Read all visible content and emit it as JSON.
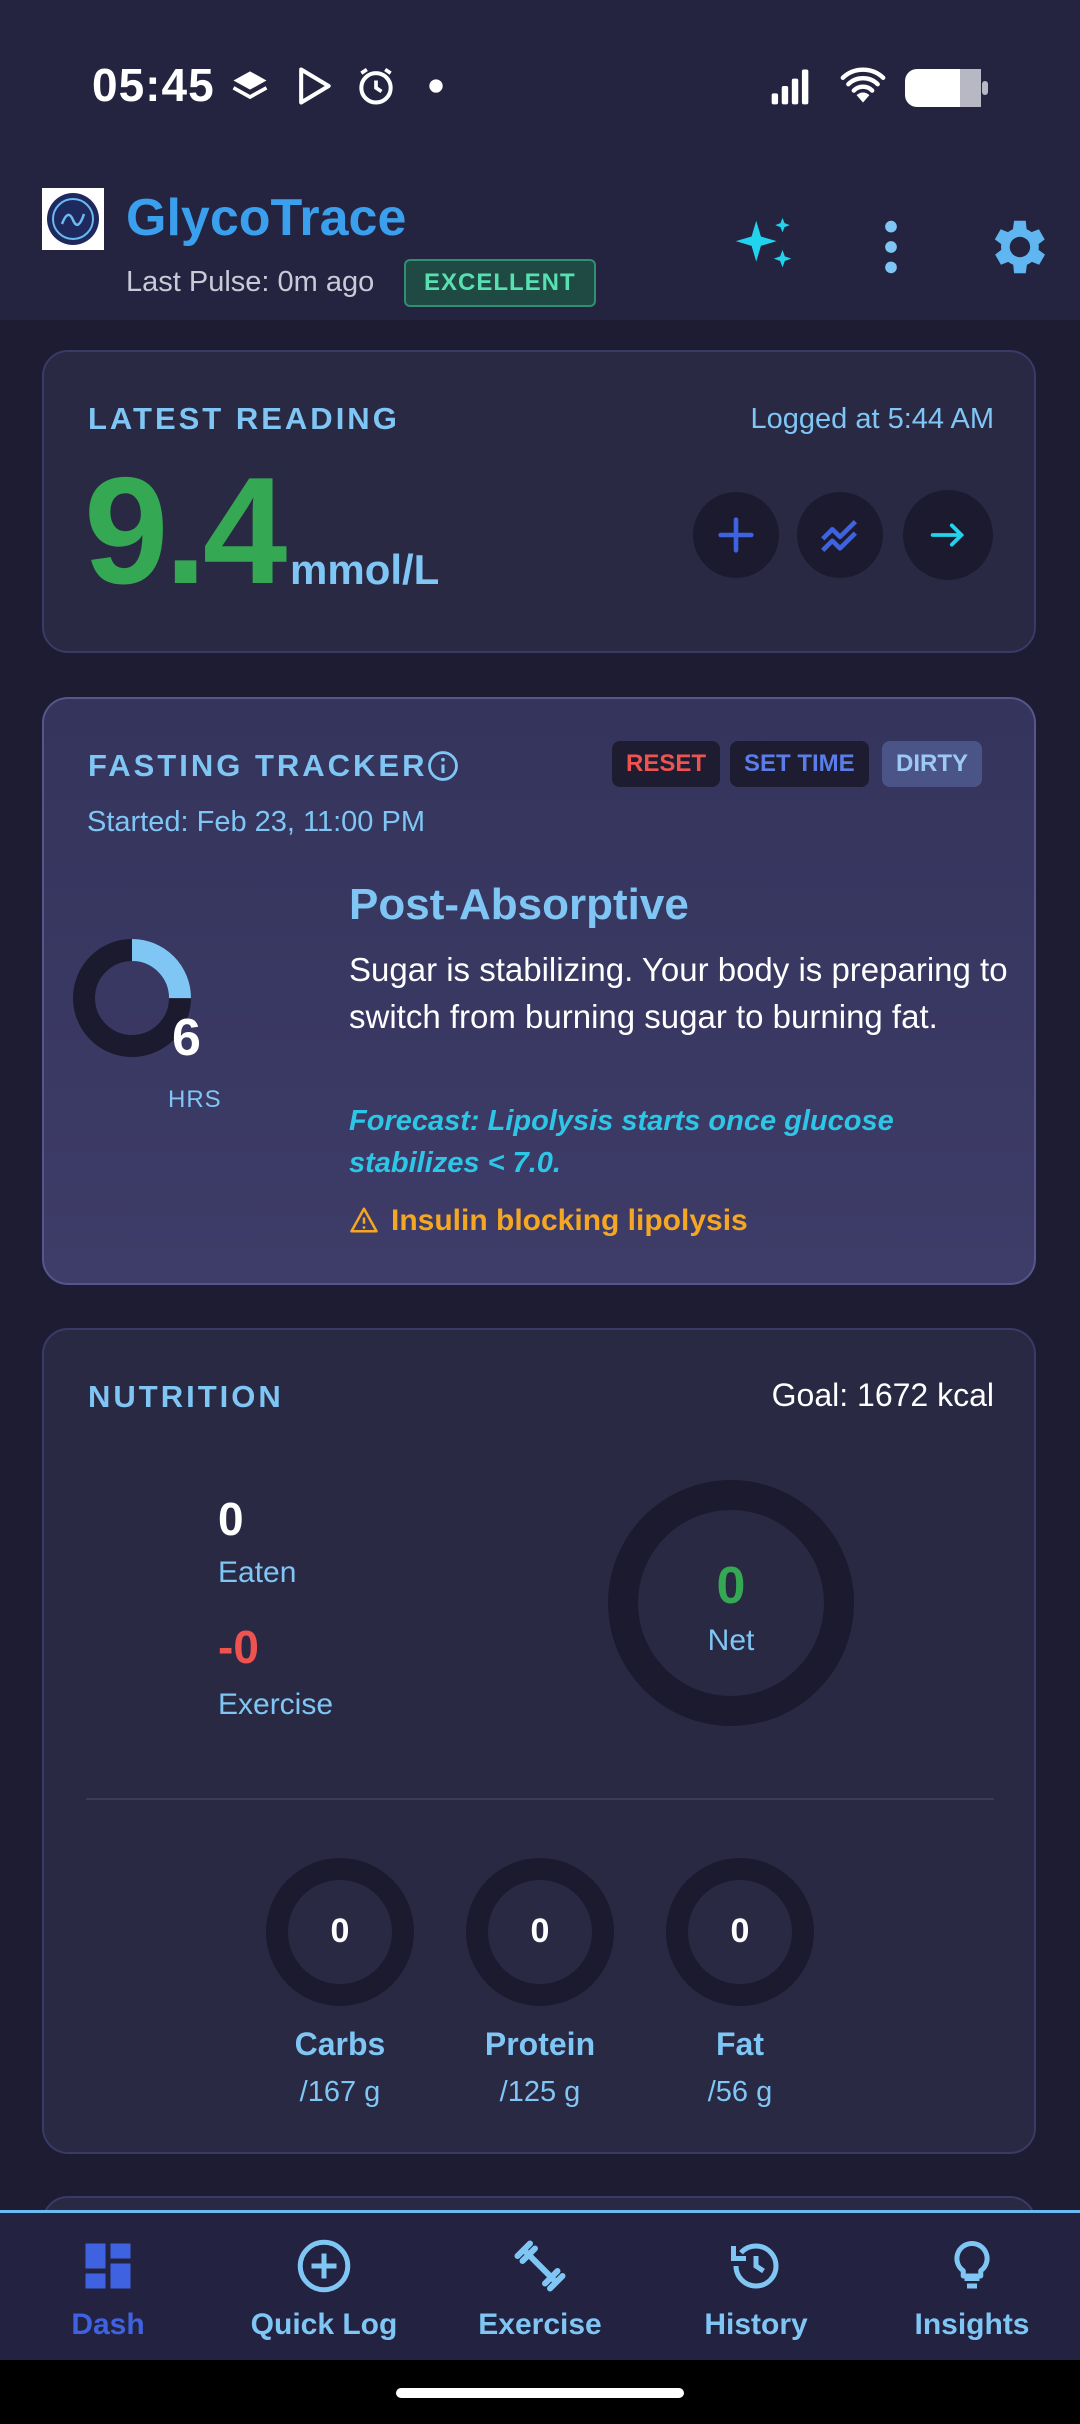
{
  "status_bar": {
    "time": "05:45",
    "icons": [
      "stack-notification-icon",
      "play-store-icon",
      "alarm-icon",
      "dot-icon",
      "signal-icon",
      "wifi-icon",
      "battery-icon"
    ]
  },
  "header": {
    "app_title": "GlycoTrace",
    "last_pulse": "Last Pulse: 0m ago",
    "badge": "EXCELLENT",
    "actions": [
      "sparkle-icon",
      "more-vert-icon",
      "settings-icon"
    ]
  },
  "latest_reading": {
    "label": "LATEST READING",
    "logged_at": "Logged at 5:44 AM",
    "value": "9.4",
    "unit": "mmol/L"
  },
  "fasting_tracker": {
    "label": "FASTING TRACKER",
    "reset": "RESET",
    "set_time": "SET TIME",
    "dirty": "DIRTY",
    "started": "Started: Feb 23, 11:00 PM",
    "hours": "6",
    "hours_label": "HRS",
    "progress_fraction": 0.25,
    "phase_title": "Post-Absorptive",
    "phase_description": "Sugar is stabilizing. Your body is preparing to switch from burning sugar to burning fat.",
    "forecast": "Forecast: Lipolysis starts once glucose stabilizes < 7.0.",
    "warning": "Insulin blocking lipolysis"
  },
  "nutrition": {
    "label": "NUTRITION",
    "goal": "Goal: 1672 kcal",
    "eaten_value": "0",
    "eaten_label": "Eaten",
    "exercise_value": "-0",
    "exercise_label": "Exercise",
    "net_value": "0",
    "net_label": "Net",
    "macros": [
      {
        "name": "Carbs",
        "value": "0",
        "goal": "/167 g"
      },
      {
        "name": "Protein",
        "value": "0",
        "goal": "/125 g"
      },
      {
        "name": "Fat",
        "value": "0",
        "goal": "/56 g"
      }
    ]
  },
  "bottom_nav": [
    {
      "label": "Dash",
      "icon": "dashboard-icon",
      "active": true
    },
    {
      "label": "Quick Log",
      "icon": "add-circle-icon",
      "active": false
    },
    {
      "label": "Exercise",
      "icon": "dumbbell-icon",
      "active": false
    },
    {
      "label": "History",
      "icon": "history-icon",
      "active": false
    },
    {
      "label": "Insights",
      "icon": "lightbulb-icon",
      "active": false
    }
  ],
  "colors": {
    "background": "#1d1c33",
    "accent_blue": "#7fc6f5",
    "reading_green": "#34a853",
    "warning_orange": "#f5a623",
    "danger_red": "#ef5350"
  }
}
